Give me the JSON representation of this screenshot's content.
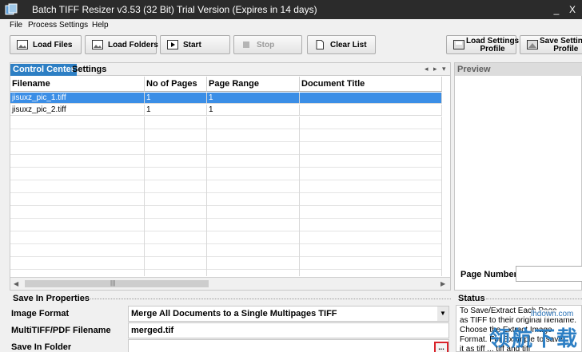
{
  "window": {
    "title": "Batch TIFF Resizer v3.53 (32 Bit)  Trial Version (Expires in 14 days)",
    "min": "_",
    "close": "X"
  },
  "menu": [
    "File",
    "Process",
    "Settings",
    "Help"
  ],
  "toolbar": {
    "load_files": "Load Files",
    "load_folders": "Load Folders",
    "start": "Start",
    "stop": "Stop",
    "clear_list": "Clear List",
    "load_profile_1": "Load Settings",
    "load_profile_2": "Profile",
    "save_profile_1": "Save Settings",
    "save_profile_2": "Profile"
  },
  "tabs": {
    "control_center": "Control Center",
    "settings": "Settings"
  },
  "table": {
    "columns": [
      "Filename",
      "No of Pages",
      "Page Range",
      "Document Title"
    ],
    "rows": [
      {
        "filename": "jisuxz_pic_1.tiff",
        "pages": "1",
        "range": "1",
        "title": ""
      },
      {
        "filename": "jisuxz_pic_2.tiff",
        "pages": "1",
        "range": "1",
        "title": ""
      }
    ]
  },
  "preview": {
    "title": "Preview",
    "page_number_label": "Page Number"
  },
  "save_props": {
    "title": "Save In Properties",
    "image_format_label": "Image Format",
    "image_format_value": "Merge All Documents to a Single Multipages TIFF",
    "filename_label": "MultiTIFF/PDF Filename",
    "filename_value": "merged.tif",
    "folder_label": "Save In Folder",
    "folder_value": "",
    "browse": "..."
  },
  "status": {
    "title": "Status",
    "lines": [
      "To Save/Extract Each Page",
      "as TIFF to their original filename.",
      "Choose the Extract Image",
      "Format. For Example to save",
      "it as tiff ... tiff and tiff"
    ]
  },
  "watermark": {
    "site": "lhdown.com",
    "text": "领航下载"
  },
  "colors": {
    "accent": "#2d7fc4",
    "selection": "#3b8ee6",
    "titlebar": "#2b2b2b"
  }
}
